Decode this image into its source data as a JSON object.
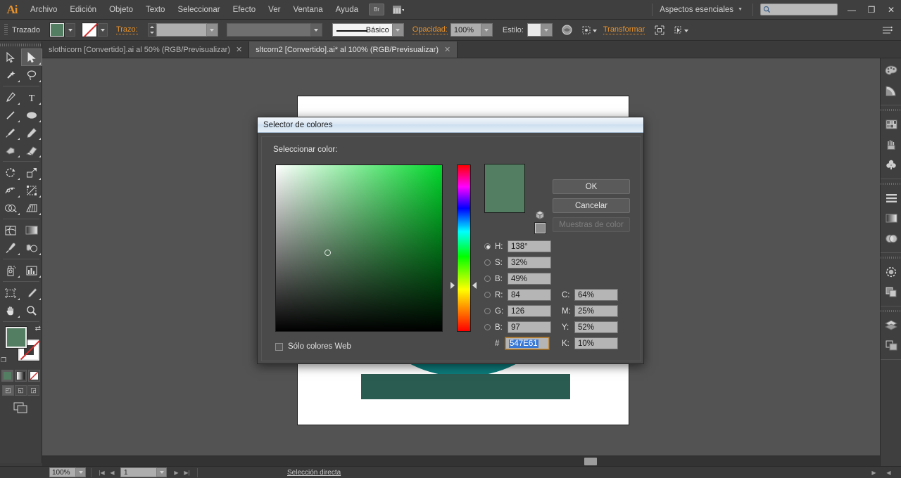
{
  "app": {
    "logo": "Ai",
    "menus": [
      "Archivo",
      "Edición",
      "Objeto",
      "Texto",
      "Seleccionar",
      "Efecto",
      "Ver",
      "Ventana",
      "Ayuda"
    ],
    "bridge_label": "Br",
    "workspace": "Aspectos esenciales",
    "search_placeholder": "",
    "window_buttons": {
      "minimize": "—",
      "restore": "❐",
      "close": "✕"
    }
  },
  "control_bar": {
    "object_label": "Trazado",
    "fill_color": "#547e61",
    "stroke_label": "Trazo:",
    "stroke_weight": "",
    "stroke_profile": "",
    "brush_label": "Básico",
    "opacity_label": "Opacidad:",
    "opacity_value": "100%",
    "style_label": "Estilo:",
    "transform_label": "Transformar"
  },
  "tabs": [
    {
      "label": "slothicorn [Convertido].ai al 50% (RGB/Previsualizar)",
      "close": "✕",
      "active": false
    },
    {
      "label": "sltcorn2 [Convertido].ai* al 100% (RGB/Previsualizar)",
      "close": "✕",
      "active": true
    }
  ],
  "toolbar": {
    "tools": [
      "selection-tool",
      "direct-selection-tool",
      "magic-wand-tool",
      "lasso-tool",
      "pen-tool",
      "type-tool",
      "line-segment-tool",
      "ellipse-tool",
      "paintbrush-tool",
      "pencil-tool",
      "blob-brush-tool",
      "eraser-tool",
      "rotate-tool",
      "scale-tool",
      "width-tool",
      "free-transform-tool",
      "shape-builder-tool",
      "perspective-grid-tool",
      "mesh-tool",
      "gradient-tool",
      "eyedropper-tool",
      "blend-tool",
      "symbol-sprayer-tool",
      "column-graph-tool",
      "artboard-tool",
      "slice-tool",
      "hand-tool",
      "zoom-tool"
    ],
    "fill_color": "#547e61",
    "stroke_color": "#ffffff",
    "selected_tool": "direct-selection-tool"
  },
  "right_dock": {
    "icons": [
      "color-panel-icon",
      "color-guide-icon",
      "swatches-panel-icon",
      "brushes-panel-icon",
      "symbols-panel-icon",
      "align-panel-icon",
      "gradient-panel-icon",
      "transparency-panel-icon",
      "stroke-panel-icon",
      "pathfinder-panel-icon",
      "layers-panel-icon",
      "artboards-panel-icon"
    ]
  },
  "status_bar": {
    "zoom": "100%",
    "page": "1",
    "status_text": "Selección directa"
  },
  "dialog": {
    "title": "Selector de colores",
    "heading": "Seleccionar color:",
    "preview_color": "#547e61",
    "buttons": {
      "ok": "OK",
      "cancel": "Cancelar",
      "swatches": "Muestras de color"
    },
    "fields": {
      "h_label": "H:",
      "h_value": "138°",
      "s_label": "S:",
      "s_value": "32%",
      "b_label": "B:",
      "b_value": "49%",
      "r_label": "R:",
      "r_value": "84",
      "g_label": "G:",
      "g_value": "126",
      "bb_label": "B:",
      "bb_value": "97",
      "hash_label": "#",
      "hex_value": "547E61",
      "c_label": "C:",
      "c_value": "64%",
      "m_label": "M:",
      "m_value": "25%",
      "y_label": "Y:",
      "y_value": "52%",
      "k_label": "K:",
      "k_value": "10%"
    },
    "selected_mode": "H",
    "web_only_label": "Sólo colores Web",
    "web_only_checked": false
  },
  "canvas": {
    "artboard_bg": "#ffffff",
    "ring_color": "#0d7b7b",
    "ring_shadow_color": "#15595e",
    "bar_color": "#2b5c52"
  }
}
